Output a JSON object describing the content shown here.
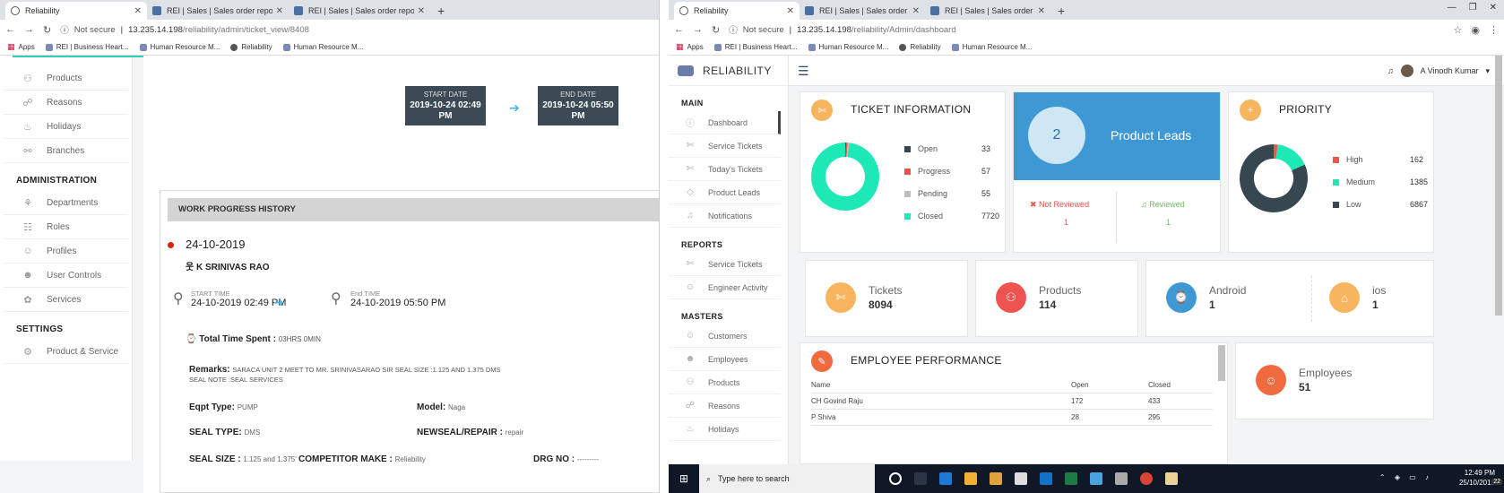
{
  "left": {
    "tabs": [
      {
        "label": "Reliability",
        "active": true,
        "icon": "reliability-icon"
      },
      {
        "label": "REI | Sales | Sales order reports |",
        "active": false,
        "icon": "rei-icon"
      },
      {
        "label": "REI | Sales | Sales order reports |",
        "active": false,
        "icon": "rei-icon"
      }
    ],
    "address": {
      "not_secure": "Not secure",
      "host": "13.235.14.198",
      "path": "/reliability/admin/ticket_view/8408"
    },
    "bookmarks": [
      "Apps",
      "REI | Business Heart...",
      "Human Resource M...",
      "Reliability",
      "Human Resource M..."
    ],
    "sidebar": {
      "group1": [
        {
          "label": "Products",
          "icon": "products-icon"
        },
        {
          "label": "Reasons",
          "icon": "reasons-icon"
        },
        {
          "label": "Holidays",
          "icon": "holidays-icon"
        },
        {
          "label": "Branches",
          "icon": "branches-icon"
        }
      ],
      "administration_title": "ADMINISTRATION",
      "administration": [
        {
          "label": "Departments",
          "icon": "departments-icon"
        },
        {
          "label": "Roles",
          "icon": "roles-icon"
        },
        {
          "label": "Profiles",
          "icon": "profiles-icon"
        },
        {
          "label": "User Controls",
          "icon": "user-controls-icon"
        },
        {
          "label": "Services",
          "icon": "services-icon"
        }
      ],
      "settings_title": "SETTINGS",
      "settings": [
        {
          "label": "Product & Service",
          "icon": "gear-icon"
        }
      ]
    },
    "start_date": {
      "label": "START DATE",
      "value": "2019-10-24 02:49 PM"
    },
    "end_date": {
      "label": "END DATE",
      "value": "2019-10-24 05:50 PM"
    },
    "work_progress": {
      "header": "WORK PROGRESS HISTORY",
      "date": "24-10-2019",
      "engineer": "K SRINIVAS RAO",
      "start_time_label": "START TIME",
      "start_time": "24-10-2019 02:49 PM",
      "end_time_label": "End TIME",
      "end_time": "24-10-2019 05:50 PM",
      "total_time_label": "Total Time Spent :",
      "total_time": "03HRS 0MIN",
      "remarks_label": "Remarks:",
      "remarks_value": "SARACA UNIT 2 MEET TO MR. SRINIVASARAO SIR SEAL SIZE :1.125 AND 1.375 DMS SEAL NOTE :SEAL SERVICES",
      "eqpt_type_label": "Eqpt Type:",
      "eqpt_type": "PUMP",
      "model_label": "Model:",
      "model": "Naga",
      "seal_type_label": "SEAL TYPE:",
      "seal_type": "DMS",
      "newseal_label": "NEWSEAL/REPAIR :",
      "newseal": "repair",
      "seal_size_label": "SEAL SIZE :",
      "seal_size": "1.125 and 1.375'",
      "competitor_label": "COMPETITOR MAKE :",
      "competitor": "Reliability",
      "drg_label": "DRG NO :",
      "drg": "---------"
    }
  },
  "right": {
    "tabs": [
      {
        "label": "Reliability",
        "active": true,
        "icon": "reliability-icon"
      },
      {
        "label": "REI | Sales | Sales order reports |",
        "active": false,
        "icon": "rei-icon"
      },
      {
        "label": "REI | Sales | Sales order reports |",
        "active": false,
        "icon": "rei-icon"
      }
    ],
    "address": {
      "not_secure": "Not secure",
      "host": "13.235.14.198",
      "path": "/reliability/Admin/dashboard"
    },
    "bookmarks": [
      "Apps",
      "REI | Business Heart...",
      "Human Resource M...",
      "Reliability",
      "Human Resource M..."
    ],
    "brand": "RELIABILITY",
    "user_name": "A Vinodh Kumar",
    "sidebar": {
      "main_title": "MAIN",
      "main": [
        {
          "label": "Dashboard",
          "icon": "info-icon"
        },
        {
          "label": "Service Tickets",
          "icon": "ticket-icon"
        },
        {
          "label": "Today's Tickets",
          "icon": "ticket-icon"
        },
        {
          "label": "Product Leads",
          "icon": "diamond-icon"
        },
        {
          "label": "Notifications",
          "icon": "bell-icon"
        }
      ],
      "reports_title": "REPORTS",
      "reports": [
        {
          "label": "Service Tickets",
          "icon": "ticket-icon"
        },
        {
          "label": "Engineer Activity",
          "icon": "user-icon"
        }
      ],
      "masters_title": "MASTERS",
      "masters": [
        {
          "label": "Customers",
          "icon": "user-icon"
        },
        {
          "label": "Employees",
          "icon": "employees-icon"
        },
        {
          "label": "Products",
          "icon": "products-icon"
        },
        {
          "label": "Reasons",
          "icon": "reasons-icon"
        },
        {
          "label": "Holidays",
          "icon": "holidays-icon"
        }
      ]
    },
    "ticket_info": {
      "title": "TICKET INFORMATION",
      "items": [
        {
          "label": "Open",
          "value": "33",
          "color": "#37474f"
        },
        {
          "label": "Progress",
          "value": "57",
          "color": "#ef5350"
        },
        {
          "label": "Pending",
          "value": "55",
          "color": "#bdbdbd"
        },
        {
          "label": "Closed",
          "value": "7720",
          "color": "#1de9b6"
        }
      ]
    },
    "product_leads": {
      "count": "2",
      "title": "Product Leads",
      "not_reviewed_label": "Not Reviewed",
      "not_reviewed": "1",
      "reviewed_label": "Reviewed",
      "reviewed": "1",
      "color": "#3d98d4"
    },
    "priority": {
      "title": "PRIORITY",
      "items": [
        {
          "label": "High",
          "value": "162",
          "color": "#ef5350"
        },
        {
          "label": "Medium",
          "value": "1385",
          "color": "#1de9b6"
        },
        {
          "label": "Low",
          "value": "6867",
          "color": "#37474f"
        }
      ]
    },
    "stats": [
      {
        "label": "Tickets",
        "value": "8094",
        "color": "#f7b55f",
        "icon": "ticket-icon"
      },
      {
        "label": "Products",
        "value": "114",
        "color": "#ef5350",
        "icon": "products-icon"
      },
      {
        "label": "Android",
        "value": "1",
        "color": "#3d98d4",
        "icon": "android-icon"
      },
      {
        "label": "ios",
        "value": "1",
        "color": "#f7b55f",
        "icon": "apple-icon"
      }
    ],
    "employee_performance": {
      "title": "EMPLOYEE PERFORMANCE",
      "columns": [
        "Name",
        "Open",
        "Closed"
      ],
      "rows": [
        [
          "CH Govind Raju",
          "172",
          "433"
        ],
        [
          "P Shiva",
          "28",
          "295"
        ]
      ]
    },
    "employees_card": {
      "label": "Employees",
      "value": "51",
      "color": "#f06a3f"
    },
    "taskbar": {
      "search_placeholder": "Type here to search",
      "time": "12:49 PM",
      "date": "25/10/2019",
      "notification_count": "22"
    }
  }
}
